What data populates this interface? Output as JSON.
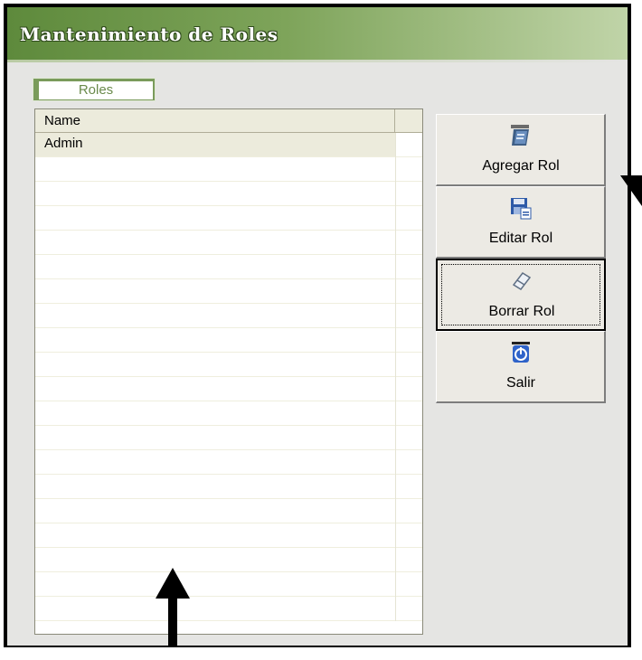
{
  "window": {
    "title": "Mantenimiento de Roles"
  },
  "tab": {
    "label": "Roles"
  },
  "grid": {
    "columns": [
      "Name"
    ],
    "rows": [
      {
        "name": "Admin"
      },
      {
        "name": ""
      },
      {
        "name": ""
      },
      {
        "name": ""
      },
      {
        "name": ""
      },
      {
        "name": ""
      },
      {
        "name": ""
      },
      {
        "name": ""
      },
      {
        "name": ""
      },
      {
        "name": ""
      },
      {
        "name": ""
      },
      {
        "name": ""
      },
      {
        "name": ""
      },
      {
        "name": ""
      },
      {
        "name": ""
      },
      {
        "name": ""
      },
      {
        "name": ""
      },
      {
        "name": ""
      },
      {
        "name": ""
      },
      {
        "name": ""
      }
    ]
  },
  "buttons": {
    "add": {
      "label": "Agregar Rol",
      "icon": "add-role-icon"
    },
    "edit": {
      "label": "Editar Rol",
      "icon": "save-edit-icon"
    },
    "delete": {
      "label": "Borrar Rol",
      "icon": "eraser-icon"
    },
    "exit": {
      "label": "Salir",
      "icon": "exit-icon"
    }
  },
  "colors": {
    "title_green": "#7ea45a",
    "window_bg": "#e5e5e3",
    "selected_row": "#ecebdc"
  }
}
